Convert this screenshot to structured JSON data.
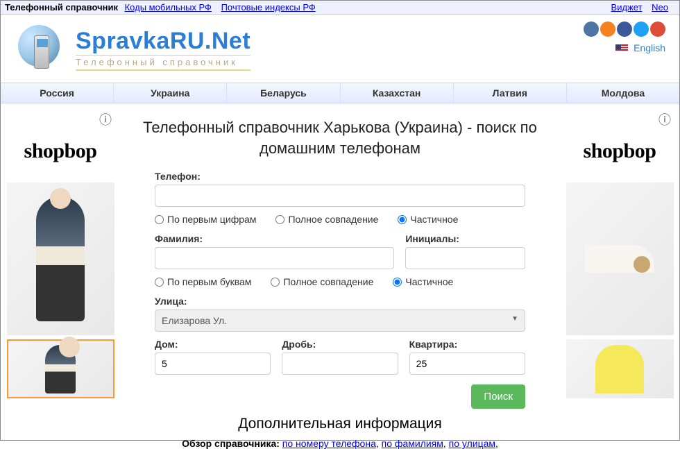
{
  "topbar": {
    "title": "Телефонный справочник",
    "links": [
      "Коды мобильных РФ",
      "Почтовые индексы РФ"
    ],
    "right": [
      "Виджет",
      "Neo"
    ]
  },
  "header": {
    "logo_main": "SpravkaRU.Net",
    "logo_sub": "Телефонный справочник",
    "lang": "English"
  },
  "nav": [
    "Россия",
    "Украина",
    "Беларусь",
    "Казахстан",
    "Латвия",
    "Молдова"
  ],
  "ads": {
    "brand": "shopbop"
  },
  "main": {
    "title": "Телефонный справочник Харькова (Украина) - поиск по домашним телефонам",
    "labels": {
      "phone": "Телефон:",
      "surname": "Фамилия:",
      "initials": "Инициалы:",
      "street": "Улица:",
      "house": "Дом:",
      "fraction": "Дробь:",
      "apartment": "Квартира:"
    },
    "radios_phone": {
      "first": "По первым цифрам",
      "full": "Полное совпадение",
      "partial": "Частичное"
    },
    "radios_name": {
      "first": "По первым буквам",
      "full": "Полное совпадение",
      "partial": "Частичное"
    },
    "values": {
      "phone": "",
      "surname": "",
      "initials": "",
      "street": "Елизарова Ул.",
      "house": "5",
      "fraction": "",
      "apartment": "25"
    },
    "search_btn": "Поиск",
    "add_info_title": "Дополнительная информация",
    "summary_label": "Обзор справочника: ",
    "summary_links": [
      "по номеру телефона",
      "по фамилиям",
      "по улицам"
    ]
  }
}
